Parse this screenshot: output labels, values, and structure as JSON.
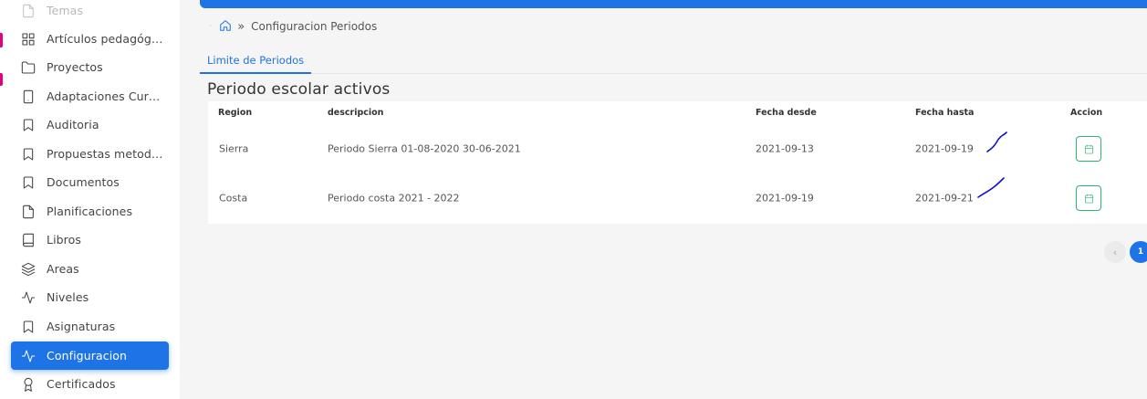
{
  "sidebar": {
    "items": [
      {
        "label": "Temas",
        "icon": "file-icon"
      },
      {
        "label": "Artículos pedagógicos",
        "icon": "grid-icon"
      },
      {
        "label": "Proyectos",
        "icon": "folder-icon"
      },
      {
        "label": "Adaptaciones Curriculares",
        "icon": "tablet-icon"
      },
      {
        "label": "Auditoria",
        "icon": "bookmark-icon"
      },
      {
        "label": "Propuestas metodológicas",
        "icon": "bookmark-icon"
      },
      {
        "label": "Documentos",
        "icon": "bookmark-icon"
      },
      {
        "label": "Planificaciones",
        "icon": "file-icon"
      },
      {
        "label": "Libros",
        "icon": "book-icon"
      },
      {
        "label": "Areas",
        "icon": "layers-icon"
      },
      {
        "label": "Niveles",
        "icon": "activity-icon"
      },
      {
        "label": "Asignaturas",
        "icon": "bookmark-icon"
      },
      {
        "label": "Configuracion",
        "icon": "activity-icon"
      },
      {
        "label": "Certificados",
        "icon": "award-icon"
      }
    ]
  },
  "breadcrumb": {
    "separator": "»",
    "current": "Configuracion Periodos"
  },
  "tabs": [
    {
      "label": "Limite de Periodos"
    }
  ],
  "section": {
    "title": "Periodo escolar activos"
  },
  "table": {
    "headers": [
      "Region",
      "descripcion",
      "Fecha desde",
      "Fecha hasta",
      "Accion"
    ],
    "rows": [
      {
        "region": "Sierra",
        "descripcion": "Periodo Sierra 01-08-2020 30-06-2021",
        "desde": "2021-09-13",
        "hasta": "2021-09-19"
      },
      {
        "region": "Costa",
        "descripcion": "Periodo costa 2021 - 2022",
        "desde": "2021-09-19",
        "hasta": "2021-09-21"
      }
    ]
  },
  "pagination": {
    "prev": "‹",
    "current_page": "1"
  },
  "colors": {
    "primary": "#1e74e6",
    "action_green": "#2bb673",
    "scribble": "#1010c8"
  }
}
